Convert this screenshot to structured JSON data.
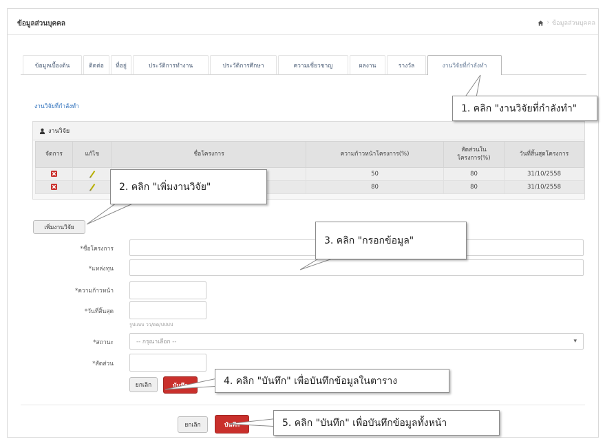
{
  "header": {
    "title": "ข้อมูลส่วนบุคคล",
    "breadcrumb_icon": "home-icon",
    "breadcrumb_separator": "›",
    "breadcrumb": "ข้อมูลส่วนบุคคล"
  },
  "tabs": [
    {
      "label": "ข้อมูลเบื้องต้น"
    },
    {
      "label": "ติดต่อ"
    },
    {
      "label": "ที่อยู่"
    },
    {
      "label": "ประวัติการทำงาน"
    },
    {
      "label": "ประวัติการศึกษา"
    },
    {
      "label": "ความเชี่ยวชาญ"
    },
    {
      "label": "ผลงาน"
    },
    {
      "label": "รางวัล"
    },
    {
      "label": "งานวิจัยที่กำลังทำ",
      "active": true
    }
  ],
  "section_link": "งานวิจัยที่กำลังทำ",
  "panel": {
    "icon": "user-icon",
    "title": "งานวิจัย",
    "columns": [
      "จัดการ",
      "แก้ไข",
      "ชื่อโครงการ",
      "ความก้าวหน้าโครงการ(%)",
      "สัดส่วนใน โครงการ(%)",
      "วันที่สิ้นสุดโครงการ"
    ],
    "rows": [
      {
        "delete_icon": "delete-icon",
        "edit_icon": "pencil-icon",
        "progress": "50",
        "share": "80",
        "end_date": "31/10/2558"
      },
      {
        "delete_icon": "delete-icon",
        "edit_icon": "pencil-icon",
        "progress": "80",
        "share": "80",
        "end_date": "31/10/2558"
      }
    ]
  },
  "add_button": "เพิ่มงานวิจัย",
  "form": {
    "fields": [
      {
        "label": "*ชื่อโครงการ"
      },
      {
        "label": "*แหล่งทุน"
      },
      {
        "label": "*ความก้าวหน้า"
      },
      {
        "label": "*วันที่สิ้นสุด",
        "hint": "รูปแบบ วว/ดด/ปปปป"
      },
      {
        "label": "*สถานะ",
        "selected": "-- กรุณาเลือก --"
      },
      {
        "label": "*สัดส่วน"
      }
    ],
    "cancel_label": "ยกเลิก",
    "save_label": "บันทึก"
  },
  "page_actions": {
    "cancel_label": "ยกเลิก",
    "save_label": "บันทึก"
  },
  "callouts": [
    "1. คลิก \"งานวิจัยที่กำลังทำ\"",
    "2. คลิก \"เพิ่มงานวิจัย\"",
    "3. คลิก \"กรอกข้อมูล\"",
    "4. คลิก \"บันทึก\" เพื่อบันทึกข้อมูลในตาราง",
    "5. คลิก \"บันทึก\" เพื่อบันทึกข้อมูลทั้งหน้า"
  ],
  "colors": {
    "link": "#2a6ebb",
    "danger": "#c9302c",
    "edit": "#b8b000",
    "callout_border": "#8a8a8a"
  }
}
